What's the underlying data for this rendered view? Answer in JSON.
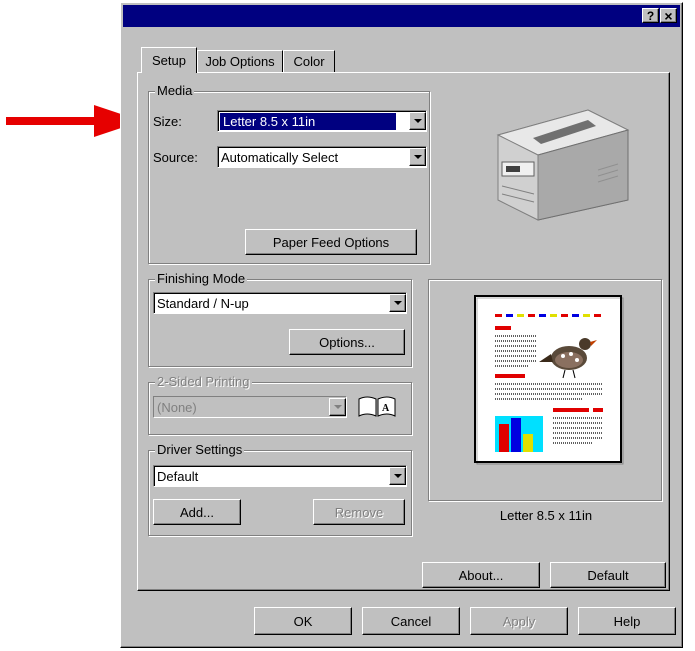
{
  "title_bar": {
    "help_btn": "?",
    "close_btn": "×"
  },
  "tabs": [
    {
      "label": "Setup"
    },
    {
      "label": "Job Options"
    },
    {
      "label": "Color"
    }
  ],
  "media": {
    "group_label": "Media",
    "size_label": "Size:",
    "size_value": "Letter 8.5 x 11in",
    "source_label": "Source:",
    "source_value": "Automatically Select",
    "paper_feed_button": "Paper Feed Options"
  },
  "finishing": {
    "group_label": "Finishing Mode",
    "value": "Standard / N-up",
    "options_button": "Options..."
  },
  "two_sided": {
    "group_label": "2-Sided Printing",
    "value": "(None)"
  },
  "driver": {
    "group_label": "Driver Settings",
    "value": "Default",
    "add_button": "Add...",
    "remove_button": "Remove"
  },
  "preview": {
    "caption": "Letter 8.5 x 11in"
  },
  "buttons": {
    "about": "About...",
    "default": "Default",
    "ok": "OK",
    "cancel": "Cancel",
    "apply": "Apply",
    "help": "Help"
  },
  "colors": {
    "titlebar": "#000080",
    "dialog": "#c0c0c0",
    "selection": "#000080",
    "arrow": "#e60000"
  }
}
